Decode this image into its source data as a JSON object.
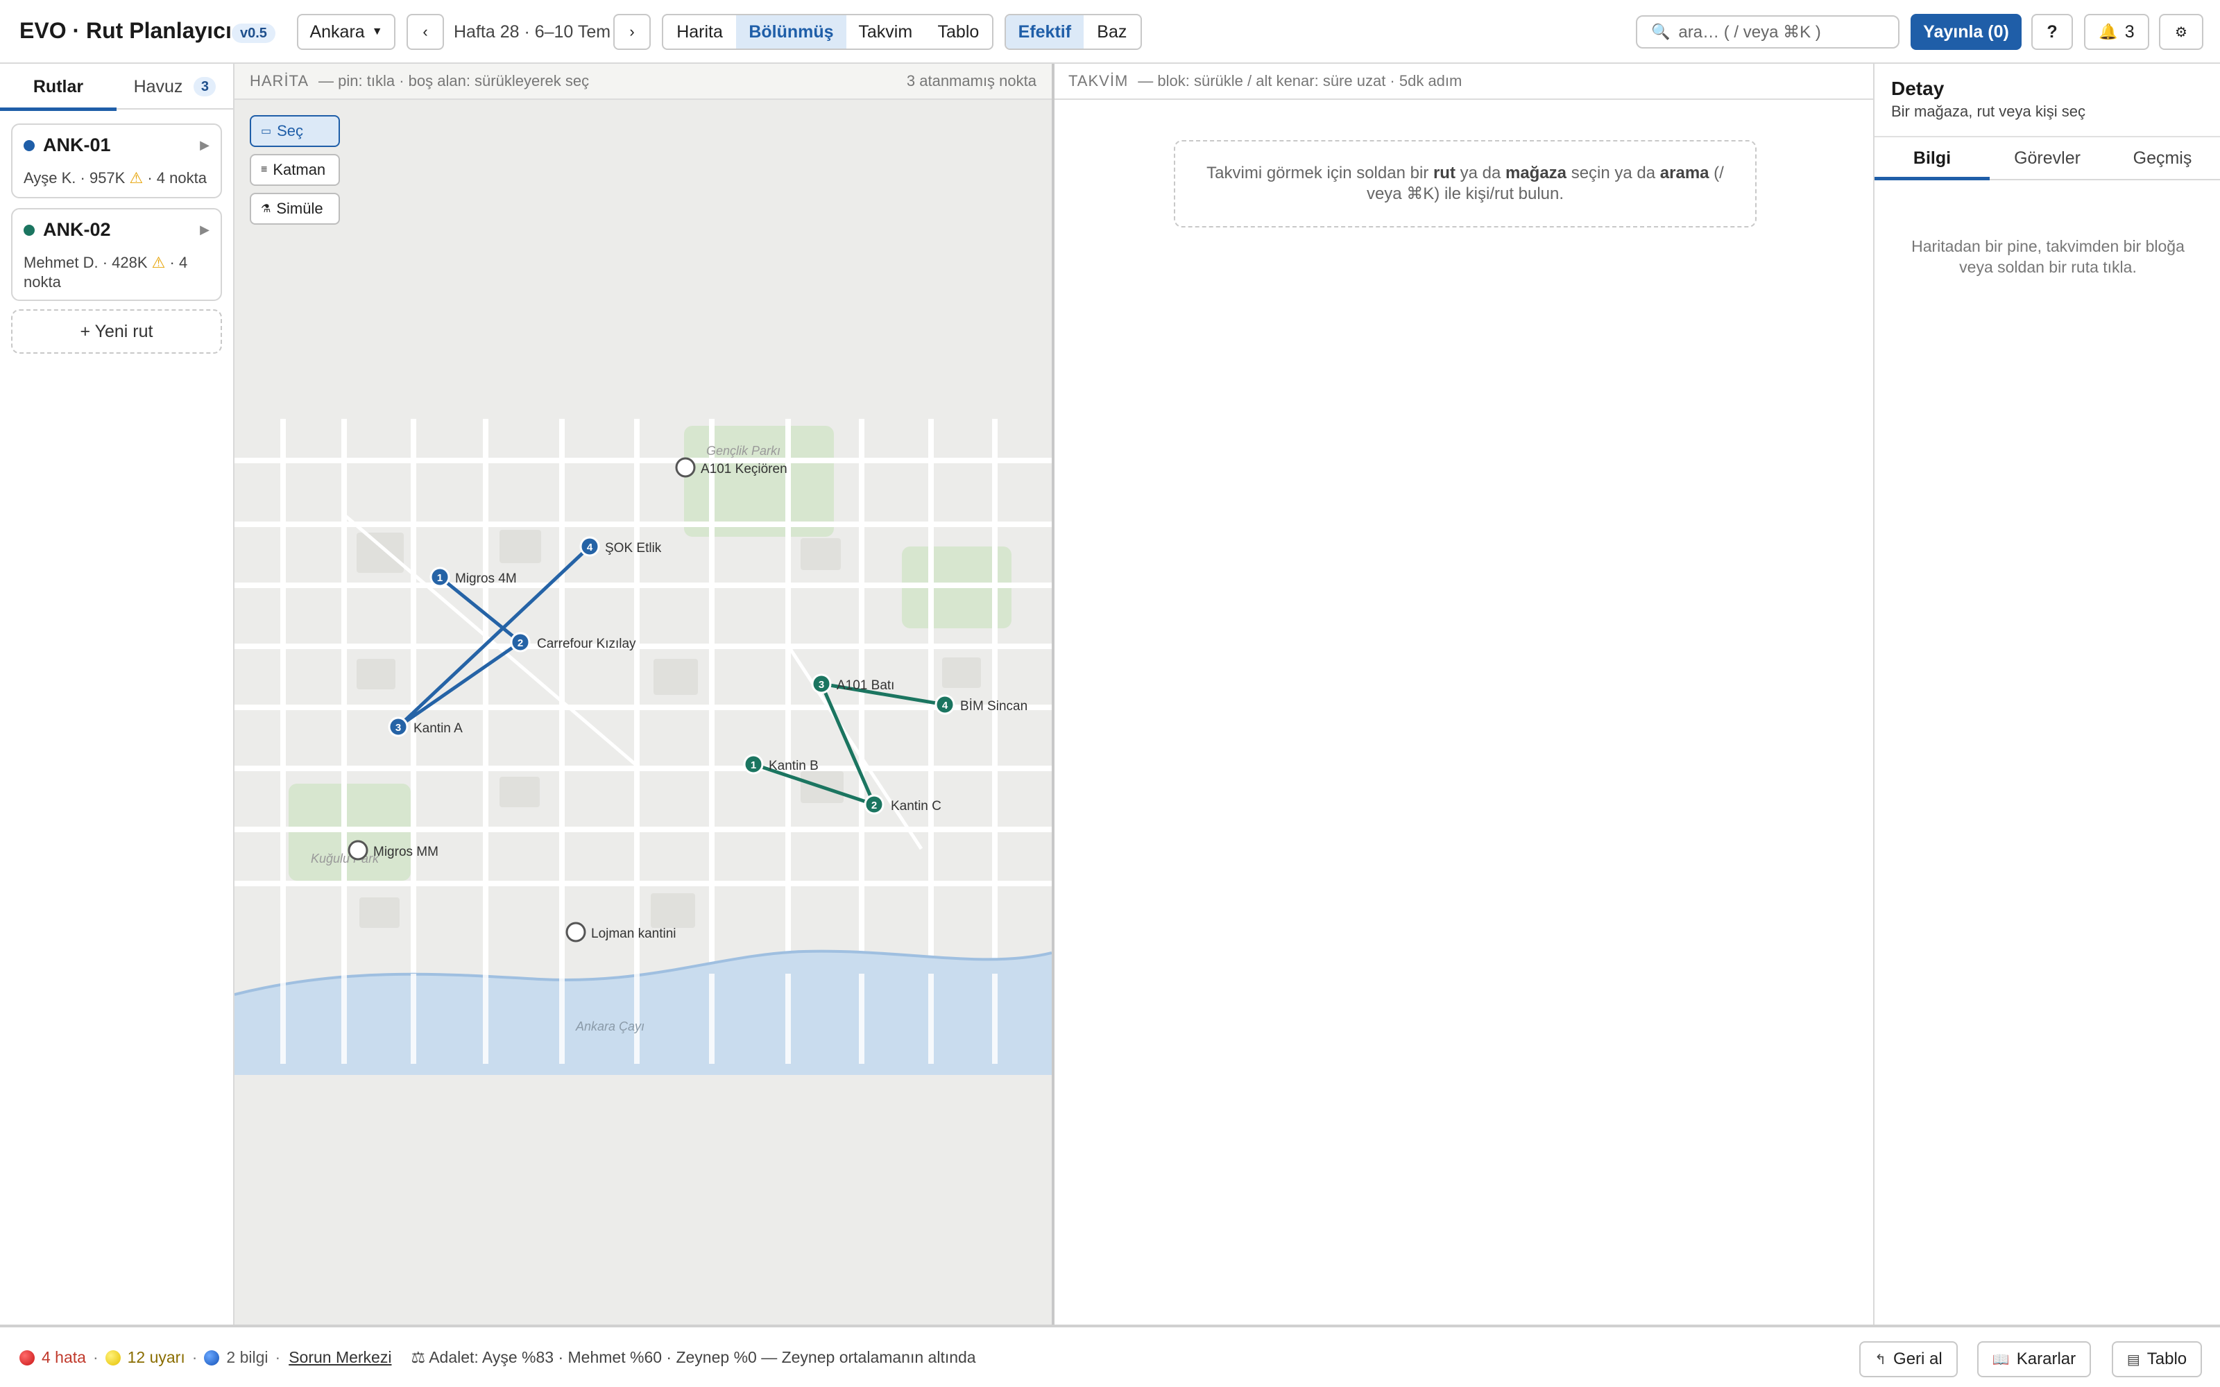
{
  "app": {
    "title": "EVO · Rut Planlayıcı",
    "version": "v0.5"
  },
  "topbar": {
    "city": "Ankara",
    "prev_label": "‹",
    "next_label": "›",
    "week_label": "Hafta 28 · 6–10 Tem",
    "views": [
      "Harita",
      "Bölünmüş",
      "Takvim",
      "Tablo"
    ],
    "active_view": "Bölünmüş",
    "modes": [
      "Efektif",
      "Baz"
    ],
    "active_mode": "Efektif",
    "search_placeholder": "ara…  ( / veya ⌘K )",
    "publish_label": "Yayınla (0)",
    "help_label": "?",
    "notifications_count": "3",
    "settings_label": "⚙"
  },
  "sidebar": {
    "tabs": [
      {
        "label": "Rutlar"
      },
      {
        "label": "Havuz",
        "count": "3"
      }
    ],
    "routes": [
      {
        "name": "ANK-01",
        "color": "#1f5ea8",
        "meta_before": "Ayşe K. · 957K",
        "meta_after": "· 4 nokta"
      },
      {
        "name": "ANK-02",
        "color": "#1b7560",
        "meta_before": "Mehmet D. · 428K",
        "meta_after": "· 4 nokta"
      }
    ],
    "new_route_label": "+ Yeni rut"
  },
  "map": {
    "title": "HARİTA",
    "hint": "— pin: tıkla · boş alan: sürükleyerek seç",
    "unassigned_label": "3 atanmamış nokta",
    "tools": {
      "select": "Seç",
      "layers": "Katman",
      "simulate": "Simüle"
    },
    "area_labels": {
      "park_north": "Gençlik Parkı",
      "park_south": "Kuğulu Park",
      "river": "Ankara Çayı"
    },
    "routes": [
      {
        "id": "ANK-01",
        "color": "#2563a6",
        "stops": [
          {
            "seq": "1",
            "name": "Migros 4M"
          },
          {
            "seq": "2",
            "name": "Carrefour Kızılay"
          },
          {
            "seq": "3",
            "name": "Kantin A"
          },
          {
            "seq": "4",
            "name": "ŞOK Etlik"
          }
        ]
      },
      {
        "id": "ANK-02",
        "color": "#1b7560",
        "stops": [
          {
            "seq": "1",
            "name": "Kantin B"
          },
          {
            "seq": "2",
            "name": "Kantin C"
          },
          {
            "seq": "3",
            "name": "A101 Batı"
          },
          {
            "seq": "4",
            "name": "BİM Sincan"
          }
        ]
      }
    ],
    "unassigned": [
      {
        "name": "A101 Keçiören"
      },
      {
        "name": "Migros MM"
      },
      {
        "name": "Lojman kantini"
      }
    ]
  },
  "calendar": {
    "title": "TAKVİM",
    "hint": "— blok: sürükle / alt kenar: süre uzat · 5dk adım",
    "empty": {
      "p1": "Takvimi görmek için soldan bir ",
      "b1": "rut",
      "p2": " ya da ",
      "b2": "mağaza",
      "p3": " seçin ya da ",
      "b3": "arama",
      "p4": " (/ veya ⌘K) ile kişi/rut bulun."
    }
  },
  "detail": {
    "title": "Detay",
    "subtitle": "Bir mağaza, rut veya kişi seç",
    "tabs": [
      "Bilgi",
      "Görevler",
      "Geçmiş"
    ],
    "active_tab": "Bilgi",
    "empty": "Haritadan bir pine, takvimden bir bloğa veya soldan bir ruta tıkla."
  },
  "statusbar": {
    "errors": "4 hata",
    "warnings": "12 uyarı",
    "infos": "2 bilgi",
    "problem_center": "Sorun Merkezi",
    "fairness": "⚖ Adalet: Ayşe %83 · Mehmet %60 · Zeynep %0 — Zeynep ortalamanın altında",
    "undo_label": "Geri al",
    "decisions_label": "Kararlar",
    "table_label": "Tablo"
  }
}
